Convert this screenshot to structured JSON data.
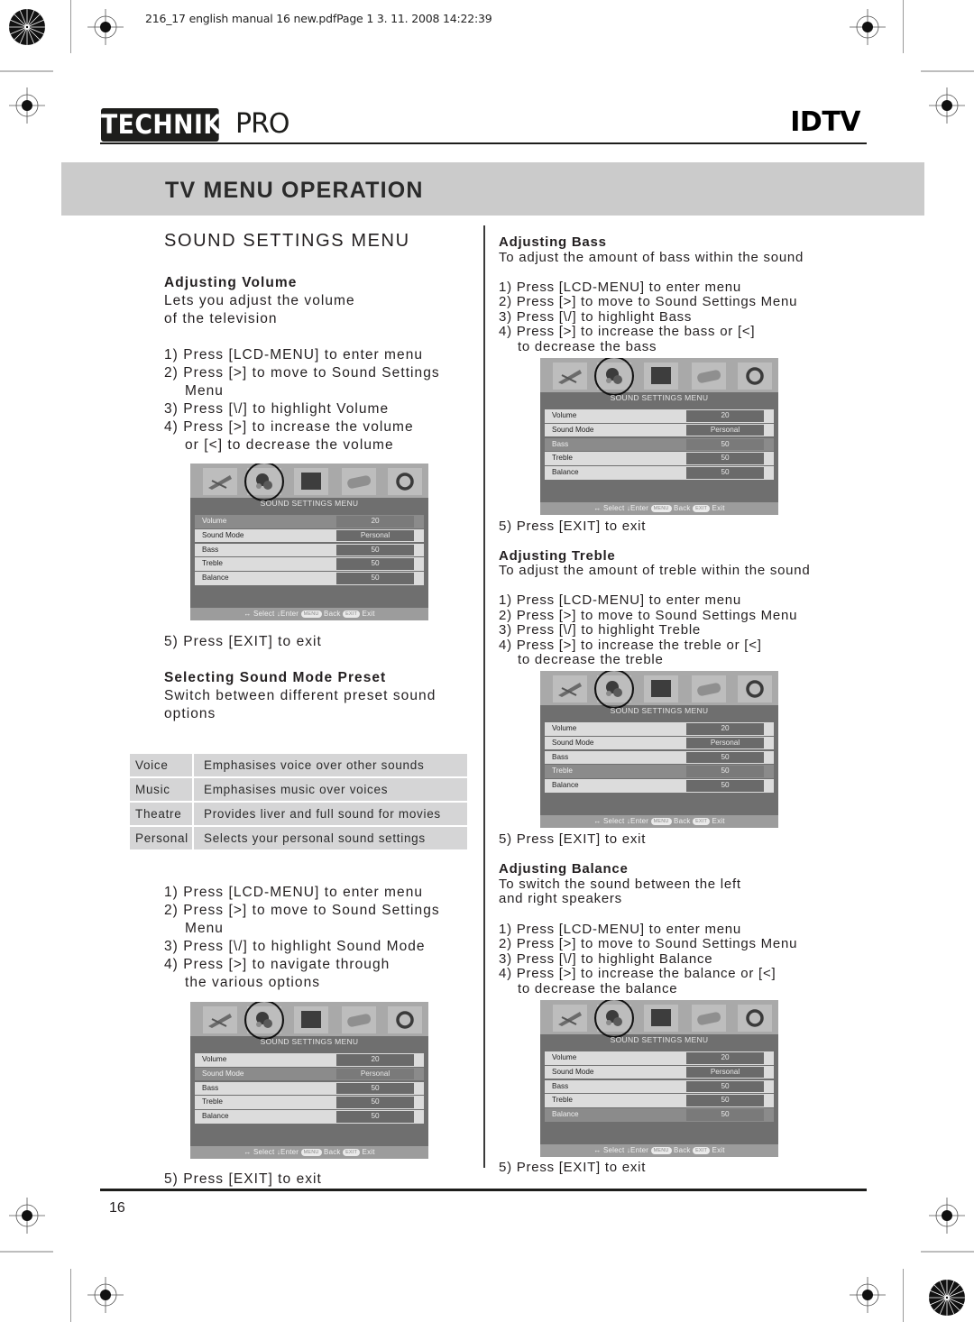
{
  "print_slug": "216_17 english manual 16 new.pdfPage 1   3. 11. 2008   14:22:39",
  "header": {
    "brand_boxed": "TECHNIKA",
    "brand_suffix": "PRO",
    "product": "IDTV"
  },
  "band_title": "TV MENU OPERATION",
  "section_title": "SOUND SETTINGS MENU",
  "osd_common": {
    "title": "SOUND SETTINGS MENU",
    "footer": {
      "select": "Select",
      "enter": "Enter",
      "menu_pill": "MENU",
      "back": "Back",
      "exit_pill": "EXIT",
      "exit": "Exit"
    },
    "icons": [
      "picture-icon",
      "sound-icon",
      "screen-icon",
      "features-icon",
      "setup-icon"
    ],
    "rows": [
      {
        "label": "Volume",
        "value": "20"
      },
      {
        "label": "Sound Mode",
        "value": "Personal"
      },
      {
        "label": "Bass",
        "value": "50"
      },
      {
        "label": "Treble",
        "value": "50"
      },
      {
        "label": "Balance",
        "value": "50"
      }
    ]
  },
  "volume": {
    "heading": "Adjusting Volume",
    "desc": [
      "Lets you adjust the volume",
      "of the television"
    ],
    "steps": [
      "1) Press [LCD-MENU] to enter menu",
      "2) Press [>] to move to Sound Settings",
      "Menu",
      "3) Press [\\/] to highlight Volume",
      "4) Press [>] to increase the volume",
      "or [<] to decrease the volume"
    ],
    "highlighted_row": "Volume",
    "exit_step": "5) Press [EXIT] to exit"
  },
  "sound_mode": {
    "heading": "Selecting Sound Mode Preset",
    "desc": [
      "Switch between different preset sound",
      "options"
    ],
    "presets": [
      {
        "name": "Voice",
        "description": "Emphasises voice over other sounds"
      },
      {
        "name": "Music",
        "description": "Emphasises music over voices"
      },
      {
        "name": "Theatre",
        "description": "Provides liver and full sound for movies"
      },
      {
        "name": "Personal",
        "description": "Selects your personal sound settings"
      }
    ],
    "steps": [
      "1) Press [LCD-MENU] to enter menu",
      "2) Press [>] to move to Sound Settings",
      "Menu",
      "3) Press [\\/] to highlight Sound Mode",
      "4) Press [>] to navigate through",
      "the various options"
    ],
    "highlighted_row": "Sound Mode",
    "exit_step": "5) Press [EXIT] to exit"
  },
  "bass": {
    "heading": "Adjusting Bass",
    "desc": [
      "To adjust the amount of bass within the sound"
    ],
    "steps": [
      "1) Press [LCD-MENU] to enter menu",
      "2) Press [>] to move to Sound Settings Menu",
      "3) Press [\\/] to highlight Bass",
      "4) Press [>] to increase the bass or [<]",
      "to decrease the bass"
    ],
    "highlighted_row": "Bass",
    "exit_step": "5) Press [EXIT] to exit"
  },
  "treble": {
    "heading": "Adjusting Treble",
    "desc": [
      "To adjust the amount of treble within the sound"
    ],
    "steps": [
      "1) Press [LCD-MENU] to enter menu",
      "2) Press [>] to move to Sound Settings Menu",
      "3) Press [\\/] to highlight Treble",
      "4) Press [>] to increase the treble or [<]",
      "to decrease the treble"
    ],
    "highlighted_row": "Treble",
    "exit_step": "5) Press [EXIT] to exit"
  },
  "balance": {
    "heading": "Adjusting Balance",
    "desc": [
      "To switch the sound between the left",
      "and right speakers"
    ],
    "steps": [
      "1) Press [LCD-MENU] to enter menu",
      "2) Press [>] to move to Sound Settings Menu",
      "3) Press [\\/] to highlight Balance",
      "4) Press [>] to increase the balance or [<]",
      "to decrease the balance"
    ],
    "highlighted_row": "Balance",
    "exit_step": "5) Press [EXIT] to exit"
  },
  "page_number": "16"
}
